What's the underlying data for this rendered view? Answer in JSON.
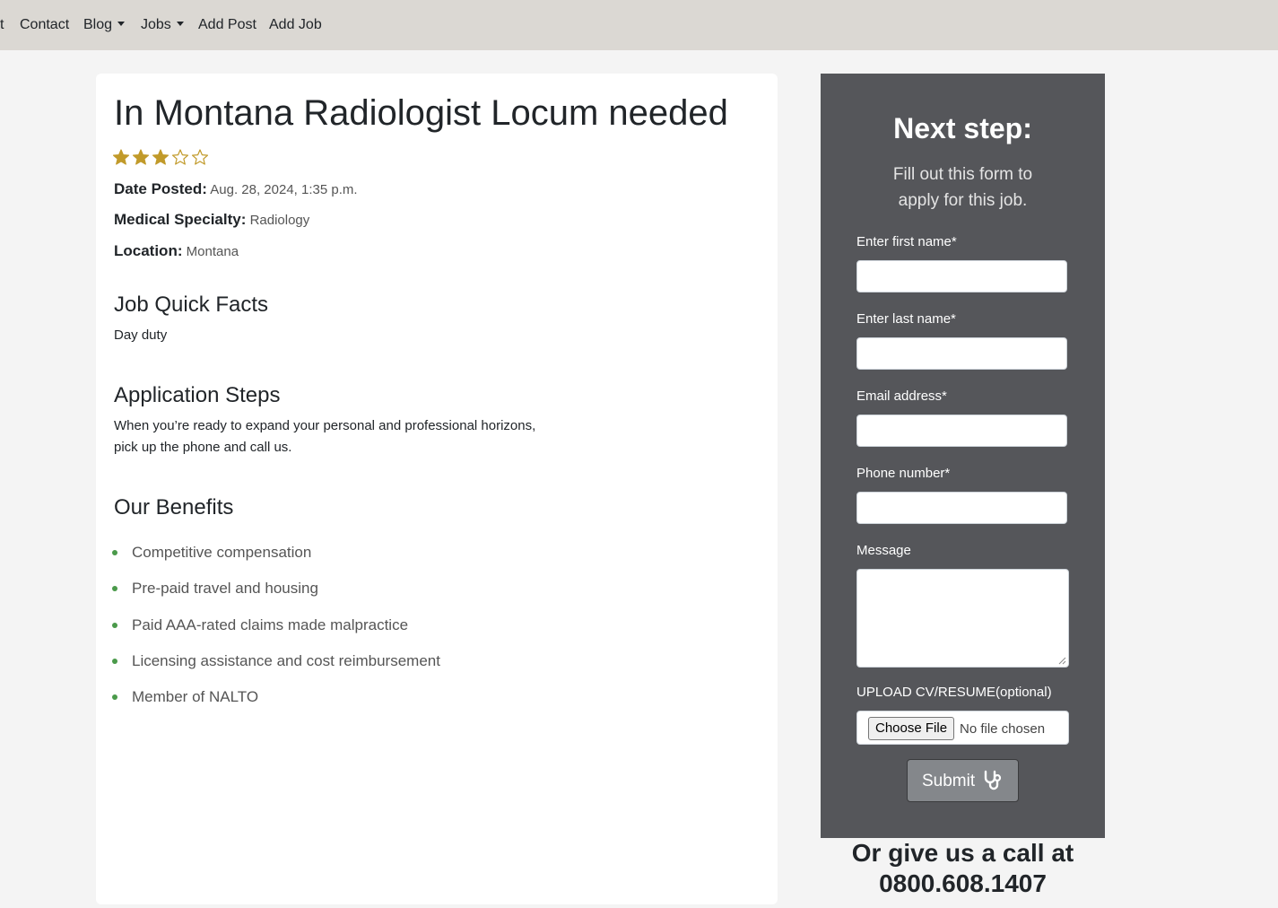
{
  "nav": {
    "items": [
      {
        "label": "t"
      },
      {
        "label": "Contact"
      },
      {
        "label": "Blog"
      },
      {
        "label": "Jobs"
      },
      {
        "label": "Add Post"
      },
      {
        "label": "Add Job"
      }
    ]
  },
  "job": {
    "title": "In Montana Radiologist Locum needed",
    "rating": {
      "filled": 3,
      "total": 5,
      "color": "#c19a2a"
    },
    "date_label": "Date Posted:",
    "date_value": "Aug. 28, 2024, 1:35 p.m.",
    "specialty_label": "Medical Specialty:",
    "specialty_value": "Radiology",
    "location_label": "Location:",
    "location_value": "Montana",
    "quick_facts_heading": "Job Quick Facts",
    "quick_facts_text": "Day duty",
    "steps_heading": "Application Steps",
    "steps_line1": "When you’re ready to expand your personal and professional horizons,",
    "steps_line2": "pick up the phone and call us.",
    "benefits_heading": "Our Benefits",
    "benefits": [
      "Competitive compensation",
      "Pre-paid travel and housing",
      "Paid AAA-rated claims made malpractice",
      "Licensing assistance and cost reimbursement",
      "Member of NALTO"
    ]
  },
  "form": {
    "title": "Next step:",
    "subtitle": "Fill out this form to apply for this job.",
    "first_name_label": "Enter first name*",
    "last_name_label": "Enter last name*",
    "email_label": "Email address*",
    "phone_label": "Phone number*",
    "message_label": "Message",
    "upload_label": "UPLOAD CV/RESUME(optional)",
    "choose_file_label": "Choose File",
    "no_file_text": "No file chosen",
    "submit_label": "Submit",
    "submit_icon": "stethoscope-icon"
  },
  "call": {
    "line1": "Or give us a call at",
    "phone": "0800.608.1407"
  },
  "colors": {
    "navbar": "#dbd8d3",
    "sidebar": "#55565a",
    "star": "#c19a2a",
    "bullet": "#4a9a4a"
  }
}
